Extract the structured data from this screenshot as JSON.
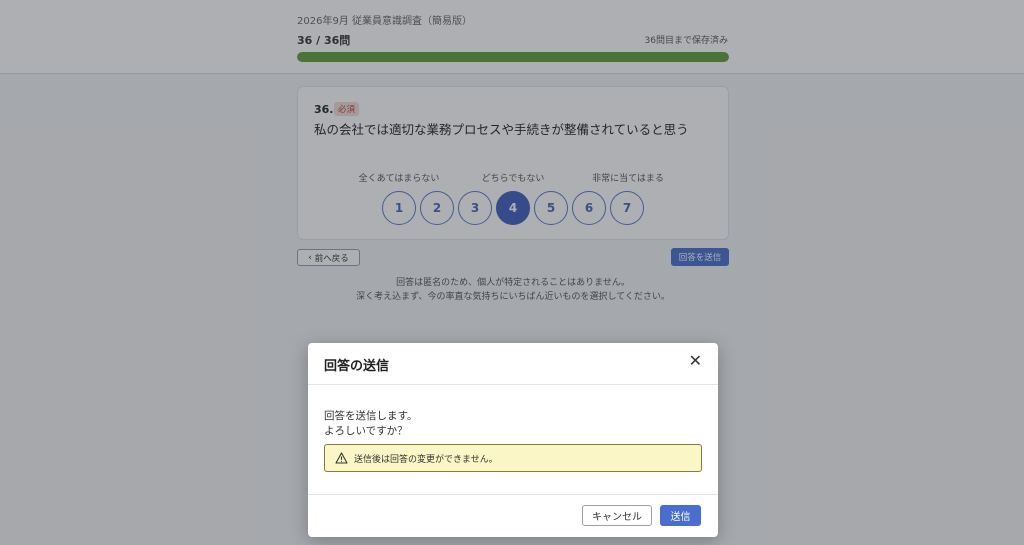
{
  "header": {
    "survey_title": "2026年9月 従業員意識調査（簡易版）",
    "progress_label": "36 / 36問",
    "saved_status": "36問目まで保存済み",
    "progress_fraction": 1.0
  },
  "question": {
    "number": "36.",
    "required_badge": "必須",
    "text": "私の会社では適切な業務プロセスや手続きが整備されていると思う",
    "scale_labels": {
      "low": "全くあてはまらない",
      "mid": "どちらでもない",
      "high": "非常に当てはまる"
    },
    "options": [
      "1",
      "2",
      "3",
      "4",
      "5",
      "6",
      "7"
    ],
    "selected": "4"
  },
  "nav": {
    "back_label": "前へ戻る",
    "submit_label": "回答を送信"
  },
  "notes": {
    "line1": "回答は匿名のため、個人が特定されることはありません。",
    "line2": "深く考え込まず、今の率直な気持ちにいちばん近いものを選択してください。"
  },
  "modal": {
    "title": "回答の送信",
    "close_icon": "close-icon",
    "message_line1": "回答を送信します。",
    "message_line2": "よろしいですか？",
    "warning": "送信後は回答の変更ができません。",
    "warning_icon": "warning-icon",
    "cancel_label": "キャンセル",
    "send_label": "送信"
  },
  "colors": {
    "accent": "#4a6ed0",
    "progress": "#5f9e3b",
    "warning_bg": "#fbf6c5"
  }
}
